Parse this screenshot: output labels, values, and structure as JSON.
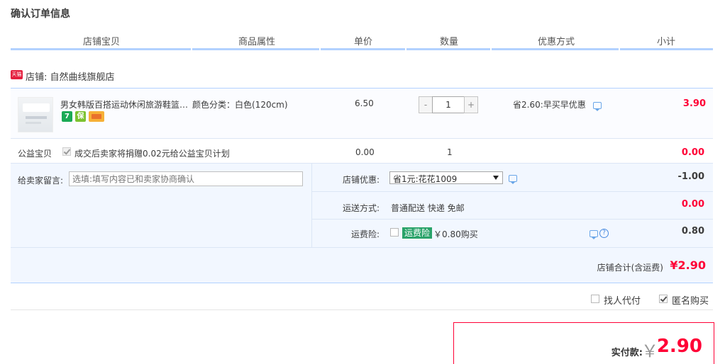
{
  "section_title": "确认订单信息",
  "columns": [
    "店铺宝贝",
    "商品属性",
    "单价",
    "数量",
    "优惠方式",
    "小计"
  ],
  "shop": {
    "badge": "天猫",
    "label": "店铺: 自然曲线旗舰店"
  },
  "item": {
    "title": "男女韩版百搭运动休闲旅游鞋篮…",
    "sku": "颜色分类：白色(120cm)",
    "price": "6.50",
    "qty_minus": "-",
    "qty_value": "1",
    "qty_plus": "+",
    "promo": "省2.60:早买早优惠",
    "subtotal": "3.90",
    "badges": [
      {
        "icon": "seven-day-return-icon",
        "text": "7",
        "color": "#1aaa55"
      },
      {
        "icon": "guarantee-icon",
        "text": "保",
        "color": "#7cc230"
      },
      {
        "icon": "credit-card-icon",
        "text": "",
        "color": "#f6b037"
      }
    ]
  },
  "charity": {
    "label": "公益宝贝",
    "text": "成交后卖家将捐赠0.02元给公益宝贝计划",
    "price": "0.00",
    "qty": "1",
    "subtotal": "0.00"
  },
  "memo": {
    "label": "给卖家留言:",
    "placeholder": "选填:填写内容已和卖家协商确认"
  },
  "shop_discount": {
    "label": "店铺优惠:",
    "selected": "省1元:花花1009",
    "amount": "-1.00"
  },
  "shipping": {
    "label": "运送方式:",
    "value": "普通配送 快递 免邮",
    "amount": "0.00"
  },
  "insurance": {
    "label": "运费险:",
    "tag": "运费险",
    "price": "￥0.80购买",
    "amount": "0.80"
  },
  "shop_total": {
    "label": "店铺合计(含运费)",
    "value": "¥2.90"
  },
  "extras": {
    "pay_for_me": "找人代付",
    "anonymous": "匿名购买"
  },
  "payment": {
    "label": "实付款:",
    "currency": "￥",
    "value": "2.90"
  }
}
